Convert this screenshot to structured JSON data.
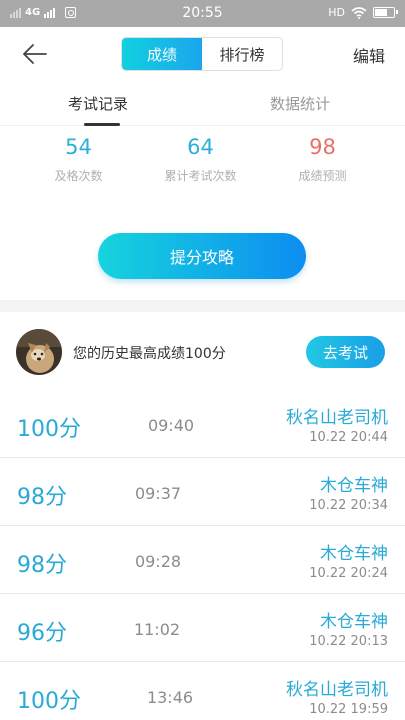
{
  "status_bar": {
    "network": "4G",
    "time": "20:55",
    "hd": "HD"
  },
  "header": {
    "tabs": [
      {
        "label": "成绩",
        "active": true
      },
      {
        "label": "排行榜",
        "active": false
      }
    ],
    "edit_label": "编辑"
  },
  "sub_tabs": [
    {
      "label": "考试记录",
      "active": true
    },
    {
      "label": "数据统计",
      "active": false
    }
  ],
  "stats": [
    {
      "value": "54",
      "label": "及格次数"
    },
    {
      "value": "64",
      "label": "累计考试次数"
    },
    {
      "value": "98",
      "label": "成绩预测"
    }
  ],
  "cta_label": "提分攻略",
  "best": {
    "text": "您的历史最高成绩100分",
    "button": "去考试"
  },
  "records": [
    {
      "score": "100分",
      "duration": "09:40",
      "name": "秋名山老司机",
      "date": "10.22  20:44"
    },
    {
      "score": "98分",
      "duration": "09:37",
      "name": "木仓车神",
      "date": "10.22  20:34"
    },
    {
      "score": "98分",
      "duration": "09:28",
      "name": "木仓车神",
      "date": "10.22  20:24"
    },
    {
      "score": "96分",
      "duration": "11:02",
      "name": "木仓车神",
      "date": "10.22  20:13"
    },
    {
      "score": "100分",
      "duration": "13:46",
      "name": "秋名山老司机",
      "date": "10.22  19:59"
    }
  ],
  "colors": {
    "accent": "#2aa9d6",
    "prediction": "#e8706a",
    "gradient_start": "#16d4dd",
    "gradient_end": "#0d8df0"
  }
}
